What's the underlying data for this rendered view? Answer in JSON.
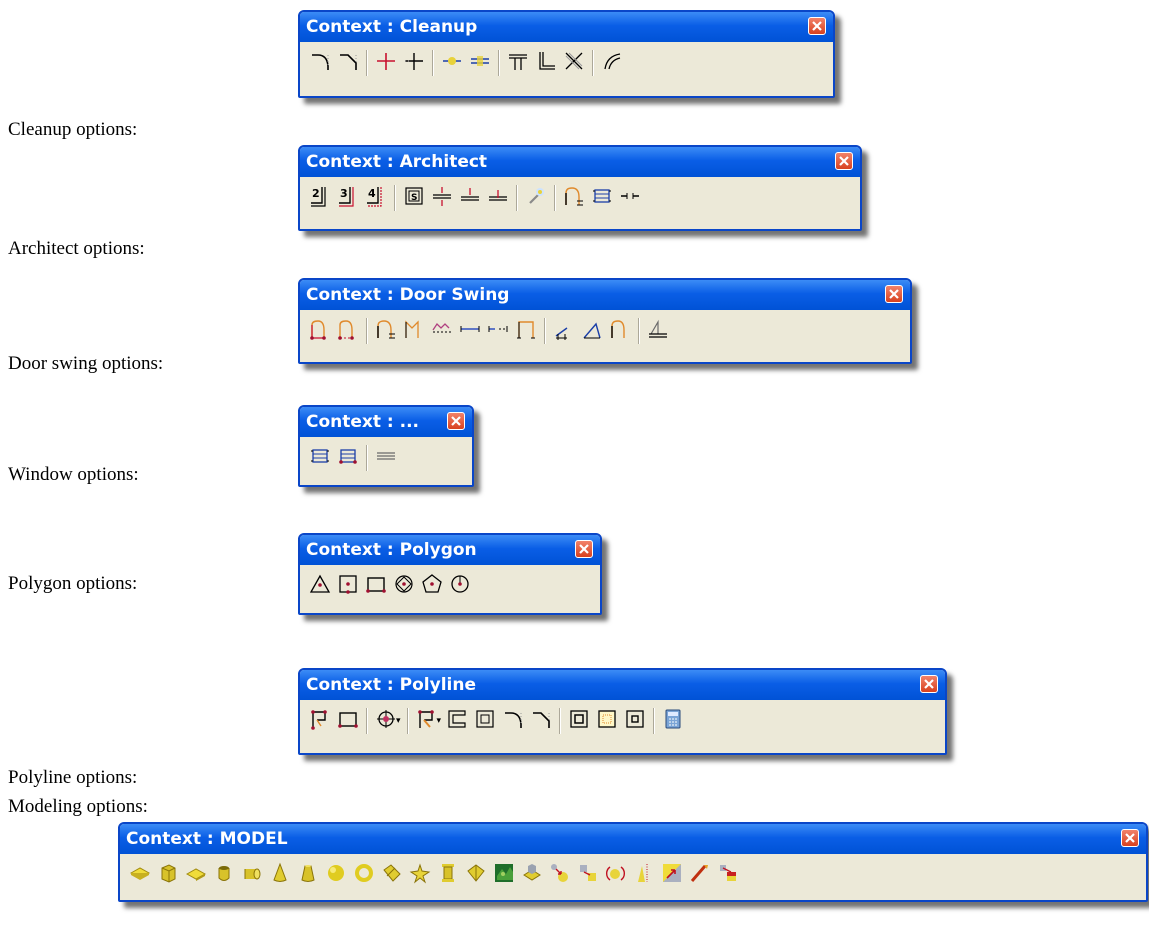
{
  "labels": {
    "cleanup": "Cleanup options:",
    "architect": "Architect options:",
    "door_swing": "Door swing options:",
    "window": "Window options:",
    "polygon": "Polygon options:",
    "polyline": "Polyline options:",
    "modeling": "Modeling options:"
  },
  "toolbars": {
    "cleanup": {
      "title": "Context : Cleanup",
      "groups": [
        [
          "fillet-icon",
          "chamfer-icon"
        ],
        [
          "cross-trim-icon",
          "cross-extend-icon"
        ],
        [
          "join-icon",
          "split-icon"
        ],
        [
          "tee-icon",
          "corner-icon",
          "cross-icon"
        ],
        [
          "arc-offset-icon"
        ]
      ]
    },
    "architect": {
      "title": "Context : Architect",
      "groups": [
        [
          "wall-2-icon",
          "wall-3-icon",
          "wall-4-icon"
        ],
        [
          "wall-style-icon",
          "wall-align-center-icon",
          "wall-align-top-icon",
          "wall-align-bottom-icon"
        ],
        [
          "magic-wand-icon"
        ],
        [
          "door-icon",
          "window-icon",
          "opening-icon"
        ]
      ]
    },
    "door_swing": {
      "title": "Context : Door Swing",
      "groups": [
        [
          "door-single-icon",
          "door-single-alt-icon"
        ],
        [
          "door-swing-icon",
          "door-double-icon",
          "door-bifold-icon",
          "door-slide-icon",
          "door-pocket-icon",
          "door-frame-icon"
        ],
        [
          "door-half-swing-icon",
          "door-quarter-swing-icon",
          "door-open-icon"
        ],
        [
          "door-threshold-icon"
        ]
      ]
    },
    "window": {
      "title": "Context : ...",
      "groups": [
        [
          "window-frame-icon",
          "window-frame-alt-icon"
        ],
        [
          "window-sill-icon"
        ]
      ]
    },
    "polygon": {
      "title": "Context : Polygon",
      "groups": [
        [
          "triangle-icon",
          "square-center-icon",
          "rectangle-icon",
          "diamond-icon",
          "pentagon-icon",
          "circle-icon"
        ]
      ]
    },
    "polyline": {
      "title": "Context : Polyline",
      "groups": [
        [
          "polyline-icon",
          "rectangle-icon"
        ],
        [
          "snap-dropdown-icon"
        ],
        [
          "edit-vertex-dropdown-icon",
          "offset-icon",
          "offset-alt-icon",
          "fillet-icon",
          "chamfer-icon"
        ],
        [
          "frame-icon",
          "frame-dotted-icon",
          "frame-inner-icon"
        ],
        [
          "calculator-icon"
        ]
      ]
    },
    "model": {
      "title": "Context : MODEL",
      "groups": [
        [
          "slab-icon",
          "box-icon",
          "wedge-icon",
          "cylinder-cup-icon",
          "cylinder-icon",
          "cone-icon",
          "frustum-icon",
          "sphere-icon",
          "torus-icon",
          "twist-icon",
          "star-icon",
          "column-icon",
          "prism-icon",
          "terrain-icon",
          "extrude-icon",
          "move-icon",
          "rotate-icon",
          "mirror-icon",
          "scale-icon",
          "paint-icon",
          "material-icon",
          "explode-icon"
        ]
      ]
    }
  },
  "colors": {
    "title_bar": "#0052d6",
    "toolbar_face": "#ece9d8",
    "close_red": "#d8411f",
    "icon_yellow": "#e8d23a",
    "icon_red": "#c8102e"
  }
}
